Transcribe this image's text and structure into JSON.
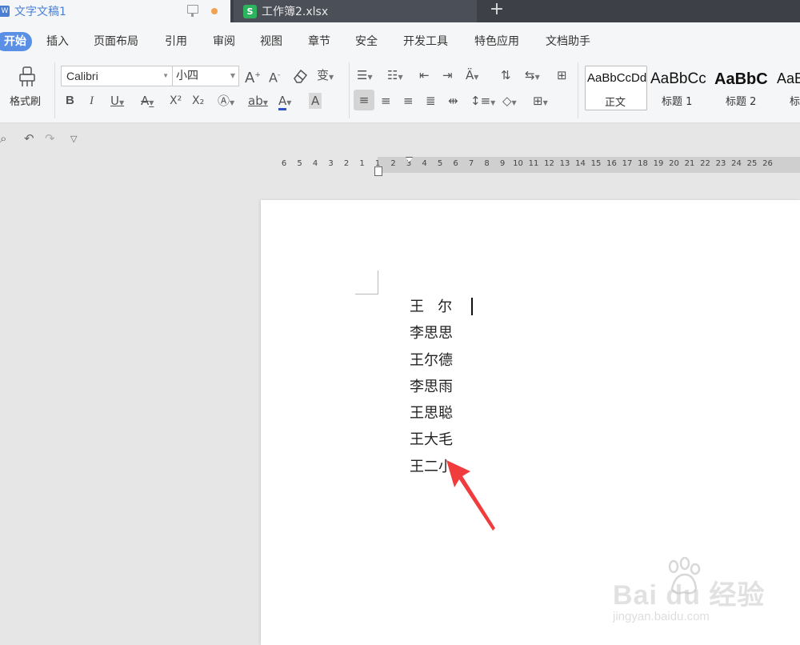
{
  "tabs": [
    {
      "badge": "W",
      "title": "文字文稿1"
    },
    {
      "badge": "S",
      "title": "工作簿2.xlsx"
    }
  ],
  "new_tab": "+",
  "menu": [
    "开始",
    "插入",
    "页面布局",
    "引用",
    "审阅",
    "视图",
    "章节",
    "安全",
    "开发工具",
    "特色应用",
    "文档助手"
  ],
  "ribbon": {
    "format_painter": "格式刷",
    "font_name": "Calibri",
    "font_size": "小四",
    "bold": "B",
    "italic": "I",
    "underline": "U",
    "strike": "A",
    "superscript": "X²",
    "subscript": "X₂",
    "font_color": "A",
    "char_shading": "A",
    "grow_font": "A",
    "shrink_font": "A",
    "phonetic": "变",
    "styles": [
      {
        "sample": "AaBbCcDd",
        "label": "正文"
      },
      {
        "sample": "AaBbCc",
        "label": "标题 1"
      },
      {
        "sample": "AaBbC",
        "label": "标题 2"
      },
      {
        "sample": "AaBl",
        "label": "标"
      }
    ]
  },
  "ruler": {
    "labels": [
      "6",
      "5",
      "4",
      "3",
      "2",
      "1",
      "1",
      "2",
      "3",
      "4",
      "5",
      "6",
      "7",
      "8",
      "9",
      "10",
      "11",
      "12",
      "13",
      "14",
      "15",
      "16",
      "17",
      "18",
      "19",
      "20",
      "21",
      "22",
      "23",
      "24",
      "25",
      "26"
    ]
  },
  "document": {
    "lines": [
      "王   尔",
      "李思思",
      "王尔德",
      "李思雨",
      "王思聪",
      "王大毛",
      "王二小"
    ]
  },
  "watermark": {
    "logo": "Bai  du 经验",
    "url": "jingyan.baidu.com"
  },
  "colors": {
    "accent": "#5a8fe6",
    "tabbar": "#3d4047",
    "sheet_green": "#2db25d",
    "arrow": "#f03c3c",
    "unsaved": "#f0a250"
  }
}
